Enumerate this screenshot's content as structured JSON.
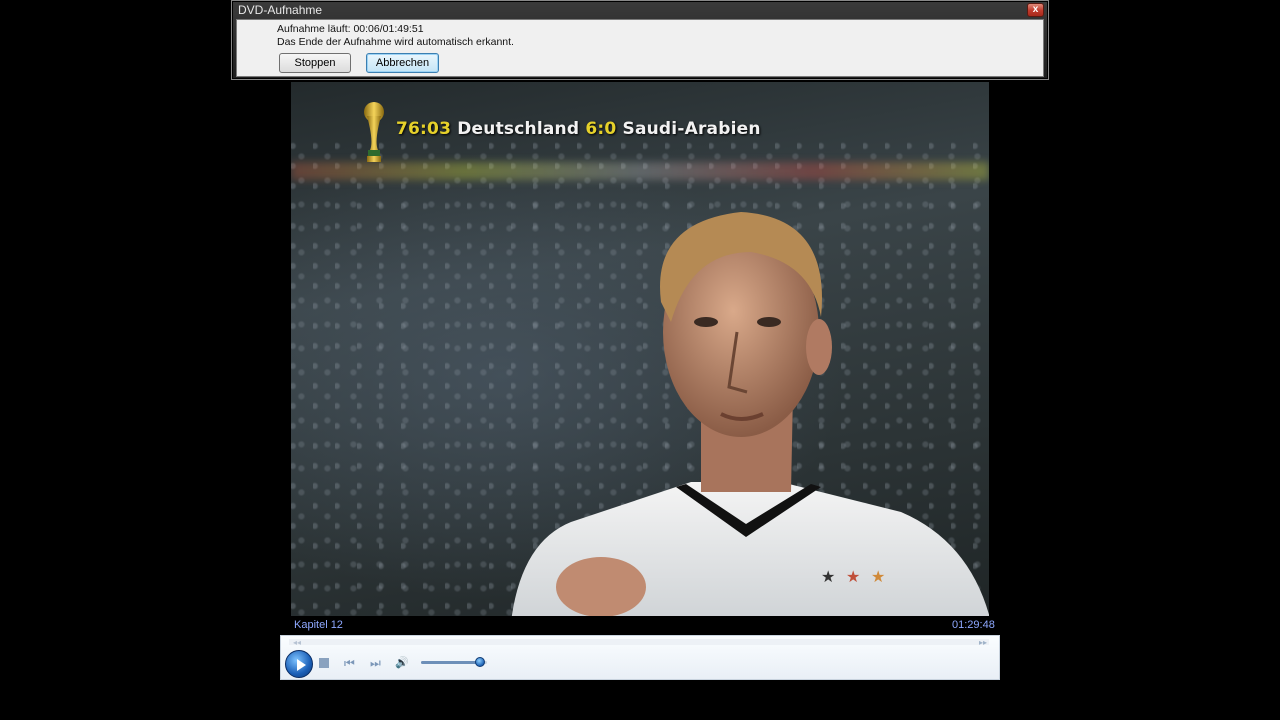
{
  "dialog": {
    "title": "DVD-Aufnahme",
    "close_symbol": "x",
    "status_line": "Aufnahme läuft: 00:06/01:49:51",
    "info_line": "Das Ende der Aufnahme wird automatisch erkannt.",
    "stop_label": "Stoppen",
    "cancel_label": "Abbrechen"
  },
  "video": {
    "score_time": "76:03",
    "team_home": "Deutschland",
    "score": "6:0",
    "team_away": "Saudi-Arabien"
  },
  "player": {
    "chapter": "Kapitel 12",
    "time": "01:29:48",
    "seek_back_symbol": "◂◂",
    "seek_fwd_symbol": "▸▸",
    "prev_symbol": "⏮",
    "next_symbol": "⏭",
    "volume_symbol": "🔊",
    "volume_level": 0.9
  }
}
